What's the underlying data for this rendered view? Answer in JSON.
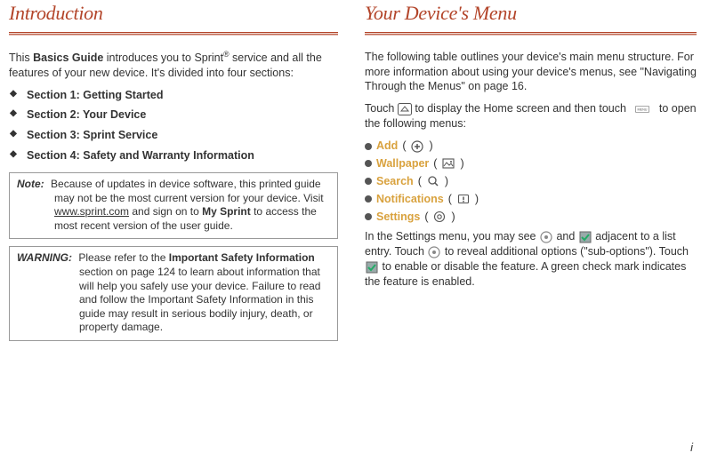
{
  "left": {
    "heading": "Introduction",
    "intro_pre": "This ",
    "intro_bold": "Basics Guide",
    "intro_mid": " introduces you to Sprint",
    "intro_post": " service and all the features of your new device. It's divided into four sections:",
    "sections": [
      {
        "label": "Section 1:",
        "title": "Getting Started"
      },
      {
        "label": "Section 2:",
        "title": "Your Device"
      },
      {
        "label": "Section 3:",
        "title": "Sprint Service"
      },
      {
        "label": "Section 4:",
        "title": "Safety and Warranty Information"
      }
    ],
    "note": {
      "label": "Note:",
      "pre": "Because of updates in device software, this printed guide may not be the most current version for your device. Visit ",
      "link": "www.sprint.com",
      "mid": " and sign on to ",
      "bold": "My Sprint",
      "post": " to access the most recent version of the user guide."
    },
    "warning": {
      "label": "WARNING:",
      "pre": "Please refer to the ",
      "bold": "Important Safety Information",
      "post": " section on page 124 to learn about information that will help you safely use your device. Failure to read and follow the Important Safety Information in this guide may result in serious bodily injury, death, or property damage."
    }
  },
  "right": {
    "heading": "Your Device's Menu",
    "para1": "The following table outlines your device's main menu structure. For more information about using your device's menus, see \"Navigating Through the Menus\" on page 16.",
    "touch_pre": "Touch ",
    "touch_mid": " to display the Home screen and then touch ",
    "touch_post": " to open the following menus:",
    "menu_label": "MENU",
    "items": [
      {
        "name": "Add",
        "icon": "plus-circle-icon"
      },
      {
        "name": "Wallpaper",
        "icon": "picture-icon"
      },
      {
        "name": "Search",
        "icon": "magnifier-icon"
      },
      {
        "name": "Notifications",
        "icon": "alert-rect-icon"
      },
      {
        "name": "Settings",
        "icon": "target-icon"
      }
    ],
    "settings1": "In the Settings menu, you may see ",
    "settings2": " and ",
    "settings3": " adjacent to a list entry. Touch ",
    "settings4": " to reveal additional options (\"sub-options\"). Touch ",
    "settings5": " to enable or disable the feature. A green check mark indicates the feature is enabled."
  },
  "page_number": "i"
}
